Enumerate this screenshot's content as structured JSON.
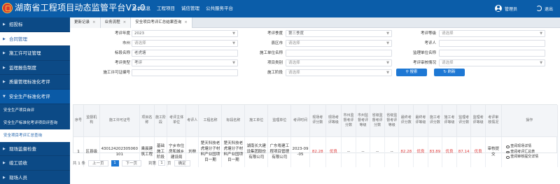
{
  "header": {
    "title": "湖南省工程项目动态监管平台V2.0",
    "nav": [
      "基本信息",
      "工程项目",
      "诚信管理",
      "公共服务平台"
    ],
    "user": "管理员",
    "logout": "退出"
  },
  "sidebar": {
    "items": [
      {
        "label": "招投标"
      },
      {
        "label": "合同管理"
      },
      {
        "label": "施工许可证管理"
      },
      {
        "label": "监理报告制度"
      },
      {
        "label": "质量管理标准化考评"
      },
      {
        "label": "安全生产标准化考评"
      }
    ],
    "subitems": [
      {
        "label": "安全生产项目自评"
      },
      {
        "label": "安全生产标准化考评项目评查询"
      },
      {
        "label": "安全项目考评汇总查询"
      }
    ],
    "items_after": [
      {
        "label": "现场监督检查"
      },
      {
        "label": "竣工验收"
      },
      {
        "label": "现场人员"
      }
    ]
  },
  "tabs": [
    {
      "label": "更新记录",
      "close": "×"
    },
    {
      "label": "业务流程",
      "close": "×"
    },
    {
      "label": "安全项目考评汇总结果查询",
      "close": "×"
    }
  ],
  "form": {
    "year_label": "考评年度",
    "year_value": "2023",
    "quarter_label": "考评季度",
    "quarter_value": "第三季度",
    "grade_label": "考评等级",
    "grade_ph": "请选择",
    "city_label": "市州",
    "city_ph": "请选择",
    "county_label": "县区市",
    "county_ph": "请选择",
    "evaluator_label": "考评人",
    "evaluator_value": "",
    "bid_label": "标段名称",
    "bid_value": "老虎塘",
    "contractor_label": "施工单位名称",
    "contractor_value": "",
    "supervisor_label": "监理单位名称",
    "supervisor_value": "",
    "eval_type_label": "考评类型",
    "eval_type_value": "考评",
    "project_type_label": "项目类别",
    "project_type_ph": "请选择",
    "review_label": "考评审核情况",
    "review_ph": "请选择",
    "permit_label": "施工许可证编号",
    "permit_value": "",
    "stage_label": "施工阶段",
    "stage_ph": "请选择",
    "search_btn": "搜索",
    "refresh_btn": "刷新"
  },
  "table": {
    "headers": [
      "序号",
      "监督机构",
      "施工许可证号",
      "项目名称",
      "施工阶段",
      "考评主体单位",
      "考评人",
      "工程名称",
      "标段名称",
      "施工单位",
      "监理单位",
      "考评时间",
      "现场考评分数",
      "现场考评等级",
      "市州监督考评分数",
      "市州监督考评等级",
      "省级监督考评分数",
      "省级监督考评等级",
      "最终考评分数",
      "最终考评等级",
      "施工考评分数",
      "施工考评等级",
      "监理考评分数",
      "监理考评等级",
      "考评审核情况",
      "操作"
    ],
    "rows": [
      {
        "cells": [
          "1",
          "区县级",
          "430124202305060101",
          "乘晨建筑工程",
          "基础施工阶段",
          "宁乡市住房和城乡建设局",
          "刘林",
          "楚天科技老虎塘分子材料产业园项目一期",
          "楚天科技老虎塘分子材料产业园项目一期",
          "湖南长大建设集团股份有限公司",
          "广东粤建工程项目管理有限公司",
          "2023-09-05",
          "82.28",
          "优良",
          "--",
          "--",
          "--",
          "--",
          "82.28",
          "优良",
          "83.89",
          "优良",
          "87.14",
          "优良",
          "审核提交"
        ],
        "ops": [
          "查阅现场详情",
          "查阅考评汇总表",
          "查阅审核提交详情"
        ]
      }
    ]
  },
  "pager": {
    "total": "共 1 条",
    "prev": "上一页",
    "page": "1",
    "next": "下一页",
    "goto_prefix": "到第",
    "goto_value": "1",
    "goto_suffix": "页",
    "confirm": "确定"
  },
  "colors": {
    "topbar": "#0b5da9",
    "sidebar": "#0c4a86",
    "primary": "#1e78d4",
    "alert": "#e03c3c"
  }
}
